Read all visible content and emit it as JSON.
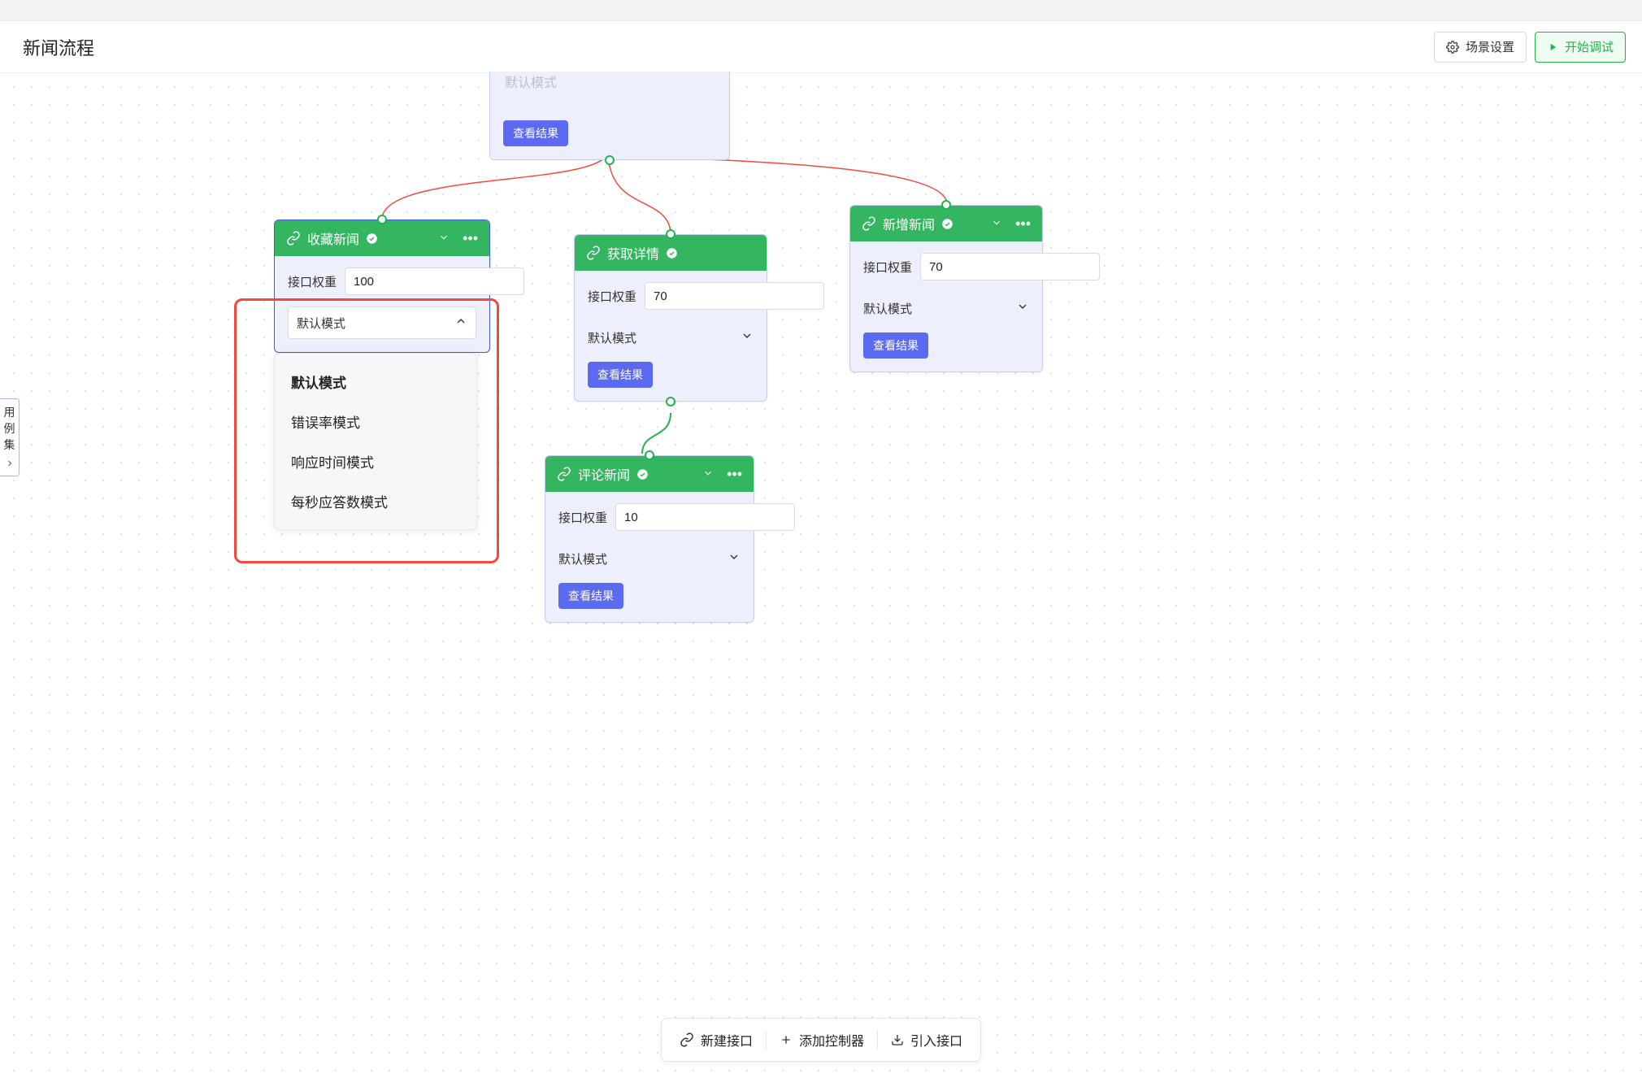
{
  "header": {
    "title": "新闻流程",
    "scene_settings": "场景设置",
    "start_debug": "开始调试"
  },
  "side_tab": {
    "label_line1": "用",
    "label_line2": "例",
    "label_line3": "集"
  },
  "field_label": "接口权重",
  "mode_label": "默认模式",
  "view_result": "查看结果",
  "top_node": {
    "truncated_text": "默认模式",
    "view": "查看结果"
  },
  "nodes": {
    "favorite": {
      "title": "收藏新闻",
      "weight": "100"
    },
    "detail": {
      "title": "获取详情",
      "weight": "70"
    },
    "addnews": {
      "title": "新增新闻",
      "weight": "70"
    },
    "comment": {
      "title": "评论新闻",
      "weight": "10"
    }
  },
  "dropdown": {
    "items": [
      "默认模式",
      "错误率模式",
      "响应时间模式",
      "每秒应答数模式"
    ],
    "selected_index": 0
  },
  "bottom_bar": {
    "new_api": "新建接口",
    "add_controller": "添加控制器",
    "import_api": "引入接口"
  }
}
